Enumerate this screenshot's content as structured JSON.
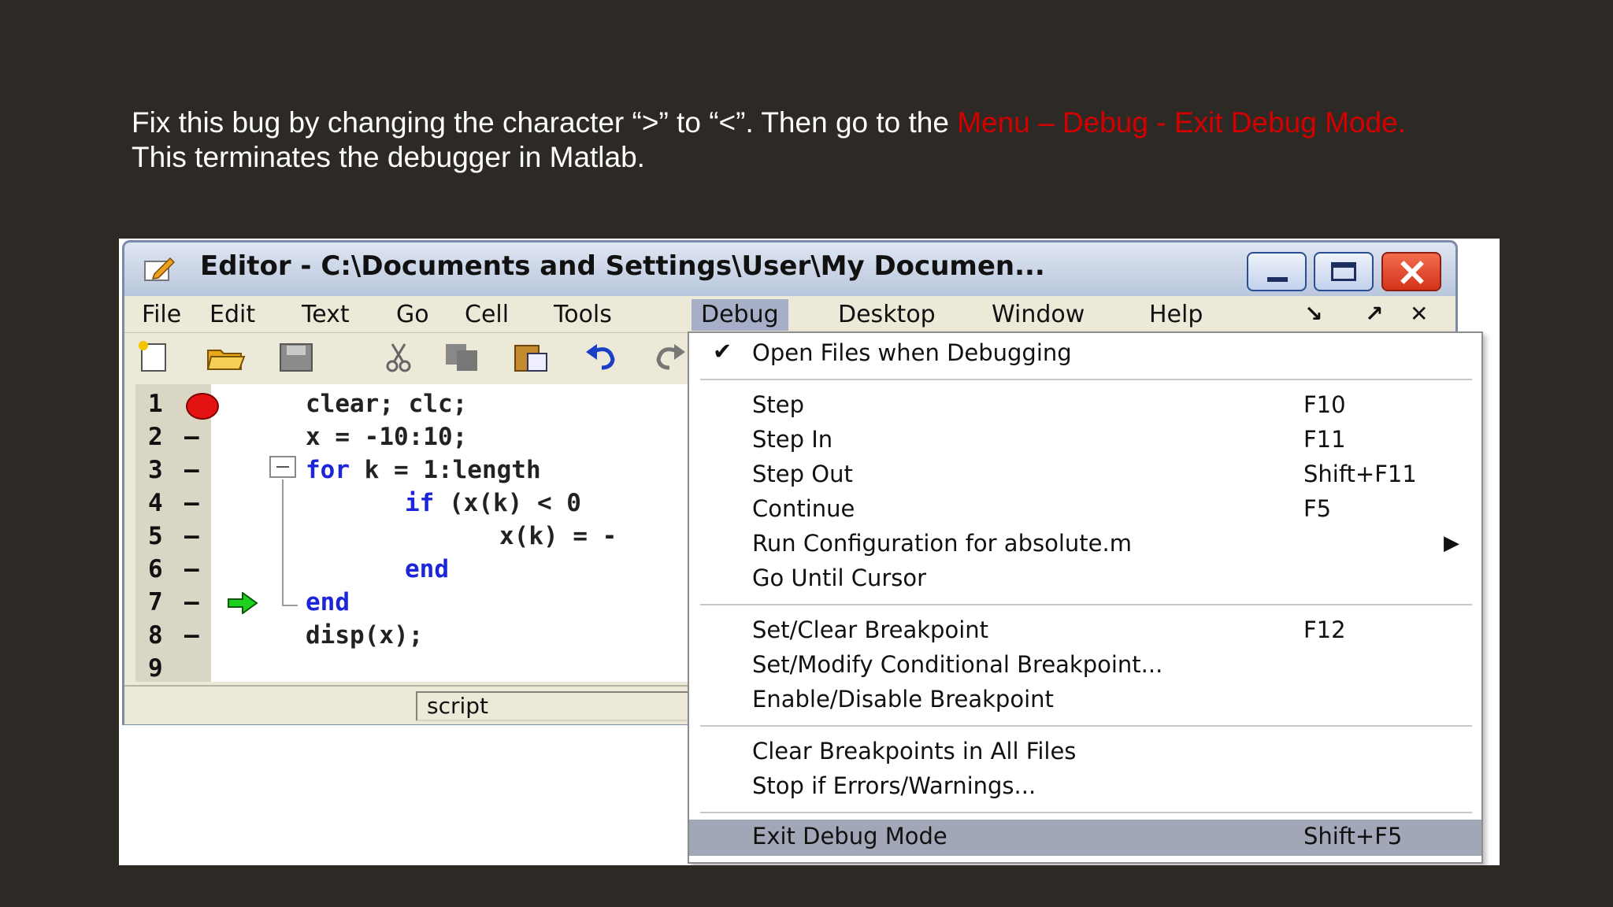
{
  "instruction": {
    "line1_prefix": "Fix this bug by changing the character “>” to “<”. Then go to the ",
    "line1_highlight": "Menu – Debug - Exit Debug Mode.",
    "line2": "This terminates the debugger in Matlab."
  },
  "editor": {
    "title": "Editor - C:\\Documents and Settings\\User\\My Documen...",
    "menu": [
      "File",
      "Edit",
      "Text",
      "Go",
      "Cell",
      "Tools",
      "Debug",
      "Desktop",
      "Window",
      "Help"
    ],
    "active_menu": "Debug",
    "toolbar_icons": [
      "new-file-icon",
      "open-folder-icon",
      "save-icon",
      "cut-icon",
      "copy-icon",
      "paste-icon",
      "undo-icon",
      "redo-icon"
    ],
    "line_numbers": [
      "1",
      "2",
      "3",
      "4",
      "5",
      "6",
      "7",
      "8",
      "9"
    ],
    "dash": "—",
    "code": {
      "l1": "clear; clc;",
      "l2": "x = -10:10;",
      "l3_kw": "for",
      "l3_rest": " k = 1:length",
      "l4_kw": "if",
      "l4_rest": " (x(k) < 0",
      "l5": "x(k) = -",
      "l6_kw": "end",
      "l7_kw": "end",
      "l8": "disp(x);"
    },
    "breakpoint_line": 1,
    "current_line": 7,
    "status": "script"
  },
  "debug_menu": {
    "check_mark": "✔",
    "submenu_arrow": "▶",
    "items": {
      "open_files": "Open Files when Debugging",
      "step": "Step",
      "step_sc": "F10",
      "step_in": "Step In",
      "step_in_sc": "F11",
      "step_out": "Step Out",
      "step_out_sc": "Shift+F11",
      "continue": "Continue",
      "continue_sc": "F5",
      "run_config": "Run Configuration for absolute.m",
      "go_until_cursor": "Go Until Cursor",
      "set_clear_bp": "Set/Clear Breakpoint",
      "set_clear_bp_sc": "F12",
      "set_modify_bp": "Set/Modify Conditional Breakpoint...",
      "enable_disable_bp": "Enable/Disable Breakpoint",
      "clear_all_bp": "Clear Breakpoints in All Files",
      "stop_if_errors": "Stop if Errors/Warnings...",
      "exit_debug": "Exit Debug Mode",
      "exit_debug_sc": "Shift+F5"
    }
  },
  "colors": {
    "background": "#2d2a26",
    "highlight_text": "#d40000",
    "keyword": "#1c26d8",
    "selected_item": "#a2a7b7"
  }
}
